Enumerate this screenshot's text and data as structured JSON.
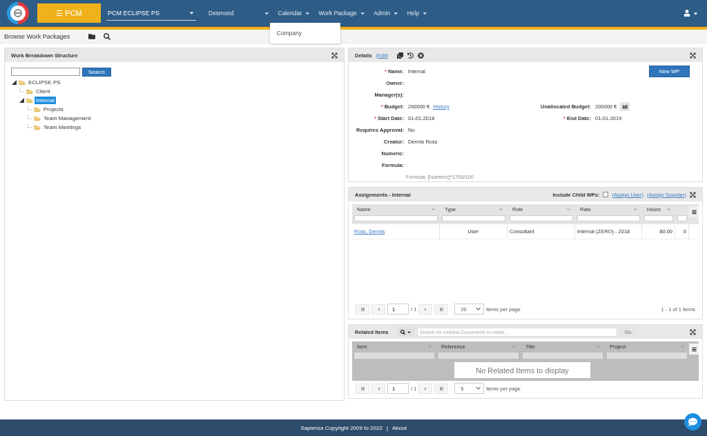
{
  "header": {
    "menu_button": "☰ PCM",
    "project_select": "PCM ECLIPSE PS",
    "menus": [
      {
        "label": "Desmond"
      },
      {
        "label": "Calendar",
        "open": true,
        "items": [
          "Company"
        ]
      },
      {
        "label": "Work Package"
      },
      {
        "label": "Admin"
      },
      {
        "label": "Help"
      }
    ]
  },
  "subbar": {
    "title": "Browse Work Packages"
  },
  "wbs": {
    "title": "Work Breakdown Structure",
    "search_button": "Search",
    "tree": [
      {
        "label": "ECLIPSE PS",
        "expanded": true,
        "selected": false,
        "children": [
          {
            "label": "Client",
            "expanded": false,
            "selected": false
          },
          {
            "label": "Internal",
            "expanded": true,
            "selected": true,
            "children": [
              {
                "label": "Projects",
                "expanded": false,
                "selected": false
              },
              {
                "label": "Team Management",
                "expanded": false,
                "selected": false
              },
              {
                "label": "Team Meetings",
                "expanded": false,
                "selected": false
              }
            ]
          }
        ]
      }
    ]
  },
  "details": {
    "title": "Details",
    "required_mark": "*",
    "edit_link": "(Edit)",
    "new_button": "New WP",
    "rows": [
      [
        {
          "label": "Name:",
          "required": true,
          "value": "Internal"
        }
      ],
      [
        {
          "label": "Owner:",
          "required": false
        }
      ],
      [
        {
          "label": "Manager(s):",
          "required": false
        }
      ],
      [
        {
          "label": "Budget:",
          "required": true,
          "value": "200000 €",
          "link": "History"
        },
        {
          "label": "Unallocated Budget:",
          "required": false,
          "value": "200000 €",
          "chart_button": true
        }
      ],
      [
        {
          "label": "Start Date:",
          "required": true,
          "value": "01-01-2018"
        },
        {
          "label": "End Date:",
          "required": true,
          "value": "01-01-2019"
        }
      ],
      [
        {
          "label": "Requires Approval:",
          "required": false,
          "value": "No"
        }
      ],
      [
        {
          "label": "Creator:",
          "required": false,
          "value": "Dennis Ross"
        }
      ],
      [
        {
          "label": "Numeric:",
          "required": false
        }
      ],
      [
        {
          "label": "Formula:",
          "required": false
        }
      ]
    ],
    "formula_note": "Formula: [Numeric]*1700/100"
  },
  "assignments": {
    "title": "Assignments - Internal",
    "include_child_label": "Include Child WPs:",
    "include_child_checked": false,
    "assign_user": "(Assign User)",
    "assign_supplier": "(Assign Supplier)",
    "columns": [
      "Name",
      "Type",
      "Role",
      "Rate",
      "Hours",
      ""
    ],
    "rows": [
      [
        "Ross, Dennis",
        "User",
        "Consultant",
        "Internal (ZERO) - 2018",
        "80.00",
        "0"
      ]
    ],
    "pager": {
      "page": "1",
      "of": "/ 1",
      "size": "20",
      "per_page": "items per page",
      "summary": "1 - 1 of 1 items"
    }
  },
  "related": {
    "title": "Related Items",
    "search_placeholder": "Search for existing Documents to relate...",
    "go_button": "Go",
    "columns": [
      "Item",
      "Reference",
      "Title",
      "Project"
    ],
    "empty_message": "No Related Items to display",
    "pager": {
      "page": "1",
      "of": "/ 1",
      "size": "5",
      "per_page": "items per page"
    }
  },
  "footer": {
    "copyright": "Sapienza Copyright 2009 to 2022",
    "separator": "|",
    "about": "About"
  }
}
